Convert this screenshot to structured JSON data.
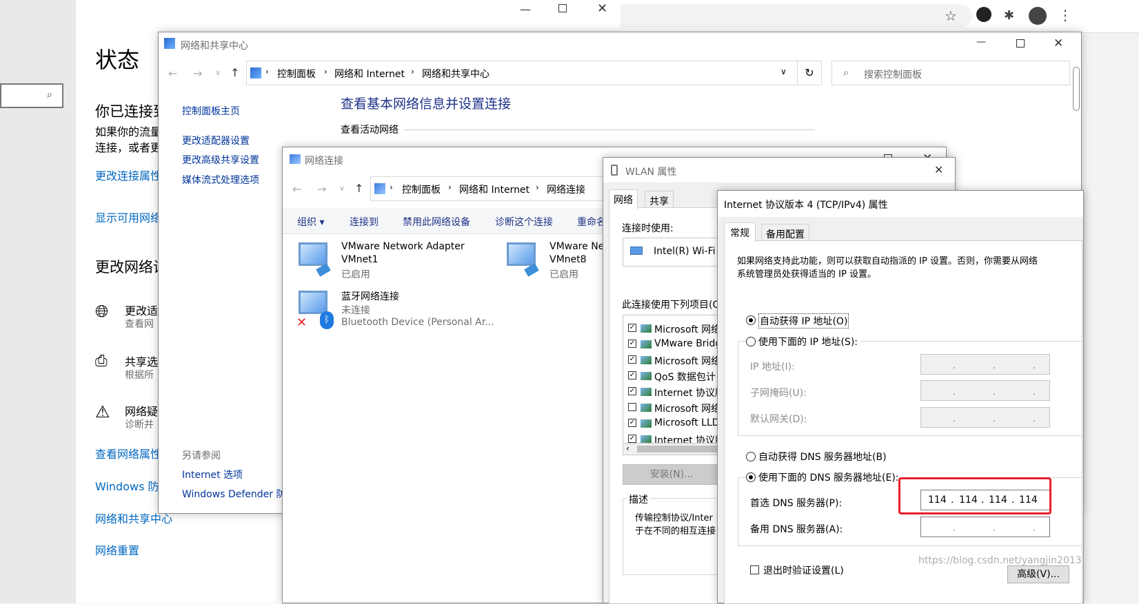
{
  "settings": {
    "title": "状态",
    "heading_connected": "你已连接到",
    "desc1": "如果你的流量",
    "desc2": "连接，或者更",
    "link_props": "更改连接属性",
    "link_available": "显示可用网络",
    "section_change": "更改网络设",
    "item1_title": "更改适",
    "item1_sub": "查看网",
    "item2_title": "共享选",
    "item2_sub": "根据所",
    "item3_title": "网络疑",
    "item3_sub": "诊断并",
    "link_view_props": "查看网络属性",
    "link_firewall": "Windows 防",
    "link_sharing_center": "网络和共享中心",
    "link_reset": "网络重置"
  },
  "nsc": {
    "title": "网络和共享中心",
    "crumbs": [
      "控制面板",
      "网络和 Internet",
      "网络和共享中心"
    ],
    "search_placeholder": "搜索控制面板",
    "side_items": [
      "控制面板主页",
      "更改适配器设置",
      "更改高级共享设置",
      "媒体流式处理选项"
    ],
    "see_also": "另请参阅",
    "see_also_items": [
      "Internet 选项",
      "Windows Defender 防"
    ],
    "heading": "查看基本网络信息并设置连接",
    "active_networks": "查看活动网络"
  },
  "netconn": {
    "title": "网络连接",
    "crumbs": [
      "控制面板",
      "网络和 Internet",
      "网络连接"
    ],
    "toolbar": [
      "组织 ▾",
      "连接到",
      "禁用此网络设备",
      "诊断这个连接",
      "重命名"
    ],
    "adapters": [
      {
        "name": "VMware Network Adapter",
        "name2": "VMnet1",
        "status": "已启用"
      },
      {
        "name": "VMware Ne",
        "name2": "VMnet8",
        "status": "已启用"
      },
      {
        "name": "蓝牙网络连接",
        "name2": "未连接",
        "status": "Bluetooth Device (Personal Ar..."
      }
    ]
  },
  "wlan": {
    "title": "WLAN 属性",
    "tabs": [
      "网络",
      "共享"
    ],
    "connect_using": "连接时使用:",
    "adapter": "Intel(R) Wi-Fi",
    "items_label": "此连接使用下列项目(O",
    "items": [
      {
        "label": "Microsoft 网络",
        "checked": true
      },
      {
        "label": "VMware Bridg",
        "checked": true
      },
      {
        "label": "Microsoft 网络",
        "checked": true
      },
      {
        "label": "QoS 数据包计",
        "checked": true
      },
      {
        "label": "Internet 协议版",
        "checked": true
      },
      {
        "label": "Microsoft 网络",
        "checked": false
      },
      {
        "label": "Microsoft LLD",
        "checked": true
      },
      {
        "label": "Internet 协议版",
        "checked": true
      }
    ],
    "install": "安装(N)...",
    "desc_label": "描述",
    "desc1": "传输控制协议/Inter",
    "desc2": "于在不同的相互连接"
  },
  "ipv4": {
    "title": "Internet 协议版本 4 (TCP/IPv4) 属性",
    "tabs": [
      "常规",
      "备用配置"
    ],
    "intro1": "如果网络支持此功能，则可以获取自动指派的 IP 设置。否则，你需要从网络",
    "intro2": "系统管理员处获得适当的 IP 设置。",
    "auto_ip": "自动获得 IP 地址(O)",
    "manual_ip": "使用下面的 IP 地址(S):",
    "ip_label": "IP 地址(I):",
    "mask_label": "子网掩码(U):",
    "gw_label": "默认网关(D):",
    "auto_dns": "自动获得 DNS 服务器地址(B)",
    "manual_dns": "使用下面的 DNS 服务器地址(E):",
    "pref_dns_label": "首选 DNS 服务器(P):",
    "pref_dns": [
      "114",
      "114",
      "114",
      "114"
    ],
    "alt_dns_label": "备用 DNS 服务器(A):",
    "validate": "退出时验证设置(L)",
    "advanced": "高级(V)..."
  },
  "highlight_color": "#e8202a",
  "watermark": "https://blog.csdn.net/yangjin2013"
}
